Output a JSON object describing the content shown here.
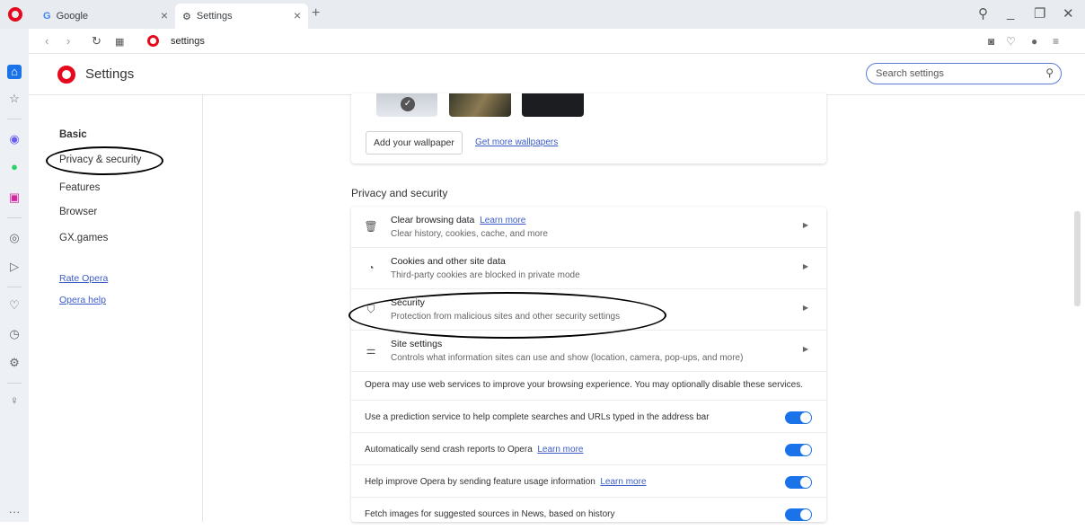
{
  "tabs": [
    {
      "label": "Google",
      "favicon": "G"
    },
    {
      "label": "Settings"
    }
  ],
  "address": {
    "url": "settings"
  },
  "header": {
    "title": "Settings",
    "search_placeholder": "Search settings"
  },
  "leftnav": {
    "items": [
      "Basic",
      "Privacy & security",
      "Features",
      "Browser",
      "GX.games"
    ],
    "links": [
      "Rate Opera",
      "Opera help"
    ]
  },
  "wallpaper": {
    "add_label": "Add your wallpaper",
    "more_label": "Get more wallpapers"
  },
  "privacy": {
    "section_title": "Privacy and security",
    "rows": [
      {
        "title": "Clear browsing data",
        "learn_more": "Learn more",
        "subtitle": "Clear history, cookies, cache, and more"
      },
      {
        "title": "Cookies and other site data",
        "subtitle": "Third-party cookies are blocked in private mode"
      },
      {
        "title": "Security",
        "subtitle": "Protection from malicious sites and other security settings"
      },
      {
        "title": "Site settings",
        "subtitle": "Controls what information sites can use and show (location, camera, pop-ups, and more)"
      }
    ],
    "notice": "Opera may use web services to improve your browsing experience. You may optionally disable these services.",
    "toggles": [
      {
        "label": "Use a prediction service to help complete searches and URLs typed in the address bar",
        "on": true
      },
      {
        "label": "Automatically send crash reports to Opera",
        "learn_more": "Learn more",
        "on": true
      },
      {
        "label": "Help improve Opera by sending feature usage information",
        "learn_more": "Learn more",
        "on": true
      },
      {
        "label": "Fetch images for suggested sources in News, based on history",
        "on": true
      }
    ]
  },
  "colors": {
    "accent": "#1a73e8",
    "brand": "#e6081c",
    "link": "#3b5cc4"
  }
}
